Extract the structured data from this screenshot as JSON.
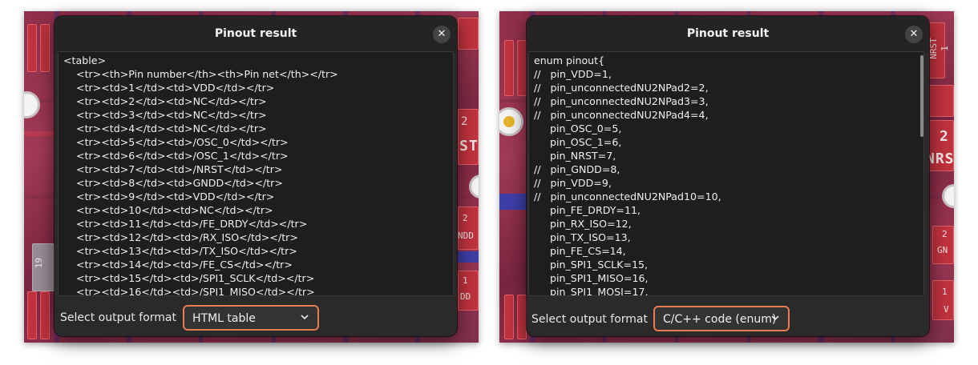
{
  "left_dialog": {
    "title": "Pinout result",
    "lines": [
      "<table>",
      "    <tr><th>Pin number</th><th>Pin net</th></tr>",
      "    <tr><td>1</td><td>VDD</td></tr>",
      "    <tr><td>2</td><td>NC</td></tr>",
      "    <tr><td>3</td><td>NC</td></tr>",
      "    <tr><td>4</td><td>NC</td></tr>",
      "    <tr><td>5</td><td>/OSC_0</td></tr>",
      "    <tr><td>6</td><td>/OSC_1</td></tr>",
      "    <tr><td>7</td><td>/NRST</td></tr>",
      "    <tr><td>8</td><td>GNDD</td></tr>",
      "    <tr><td>9</td><td>VDD</td></tr>",
      "    <tr><td>10</td><td>NC</td></tr>",
      "    <tr><td>11</td><td>/FE_DRDY</td></tr>",
      "    <tr><td>12</td><td>/RX_ISO</td></tr>",
      "    <tr><td>13</td><td>/TX_ISO</td></tr>",
      "    <tr><td>14</td><td>/FE_CS</td></tr>",
      "    <tr><td>15</td><td>/SPI1_SCLK</td></tr>",
      "    <tr><td>16</td><td>/SPI1_MISO</td></tr>"
    ],
    "format_label": "Select output format",
    "format_value": "HTML table"
  },
  "right_dialog": {
    "title": "Pinout result",
    "lines": [
      "enum pinout{",
      "//   pin_VDD=1,",
      "//   pin_unconnectedNU2NPad2=2,",
      "//   pin_unconnectedNU2NPad3=3,",
      "//   pin_unconnectedNU2NPad4=4,",
      "     pin_OSC_0=5,",
      "     pin_OSC_1=6,",
      "     pin_NRST=7,",
      "//   pin_GNDD=8,",
      "//   pin_VDD=9,",
      "//   pin_unconnectedNU2NPad10=10,",
      "     pin_FE_DRDY=11,",
      "     pin_RX_ISO=12,",
      "     pin_TX_ISO=13,",
      "     pin_FE_CS=14,",
      "     pin_SPI1_SCLK=15,",
      "     pin_SPI1_MISO=16,",
      "     pin_SPI1_MOSI=17,"
    ],
    "format_label": "Select output format",
    "format_value": "C/C++ code (enum)"
  },
  "pcb_labels": {
    "left_edge": "19",
    "left_nst": "ST",
    "left_2": "2",
    "left_2b": "2",
    "left_ndd": "NDD",
    "left_1": "1",
    "left_dd": "DD",
    "right_nrst_small": "NRST",
    "right_1_small": "1",
    "right_2": "2",
    "right_nrs": "NRS",
    "right_2b": "2",
    "right_gn": "GN",
    "right_1": "1",
    "right_v": "V"
  },
  "colors": {
    "dialog_bg": "#2a2a2a",
    "select_border": "#e77e53",
    "pcb_base": "#8f2f4a"
  },
  "icons": {
    "close": "close-icon",
    "dropdown": "chevron-down-icon"
  }
}
